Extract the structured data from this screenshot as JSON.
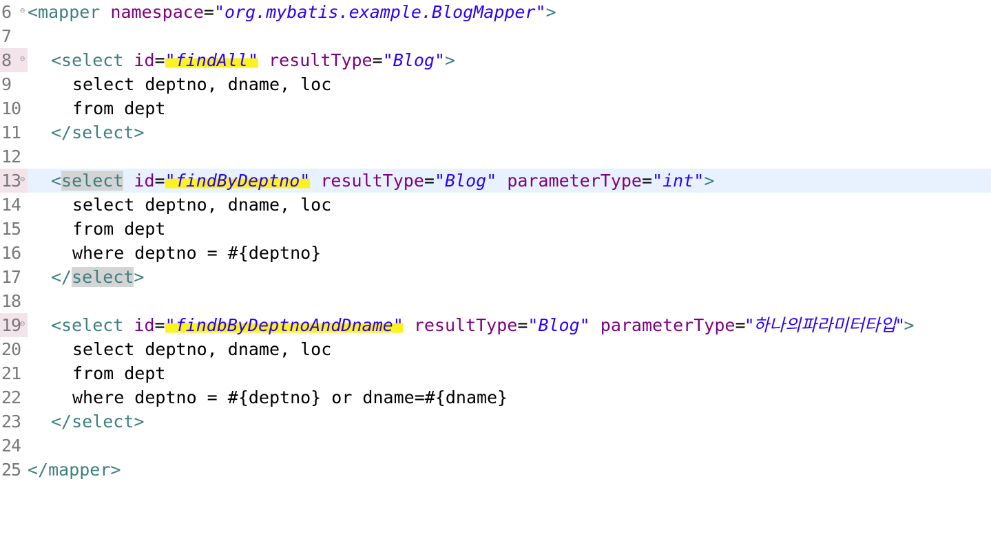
{
  "lines": {
    "l6": {
      "num": "6",
      "t1": "<mapper",
      "a1": " namespace",
      "eq": "=",
      "v1": "\"org.mybatis.example.BlogMapper\"",
      "t2": ">"
    },
    "l7": {
      "num": "7"
    },
    "l8": {
      "num": "8",
      "t1": "<select",
      "a1": " id",
      "v1": "\"findAll\"",
      "a2": " resultType",
      "v2": "\"Blog\"",
      "t2": ">"
    },
    "l9": {
      "num": "9",
      "text": "select deptno, dname, loc"
    },
    "l10": {
      "num": "10",
      "text": "from dept"
    },
    "l11": {
      "num": "11",
      "t1": "</select>"
    },
    "l12": {
      "num": "12"
    },
    "l13": {
      "num": "13",
      "t0": "<",
      "sel": "select",
      "a1": " id",
      "v1": "\"findByDeptno\"",
      "a2": " resultType",
      "v2": "\"Blog\"",
      "a3": " parameterType",
      "v3": "\"int\"",
      "t2": ">"
    },
    "l14": {
      "num": "14",
      "text": "select deptno, dname, loc"
    },
    "l15": {
      "num": "15",
      "text": "from dept"
    },
    "l16": {
      "num": "16",
      "text": "where deptno = #{deptno}"
    },
    "l17": {
      "num": "17",
      "t0": "</",
      "sel": "select",
      "t2": ">"
    },
    "l18": {
      "num": "18"
    },
    "l19": {
      "num": "19",
      "t1": "<select",
      "a1": " id",
      "v1": "\"findbByDeptnoAndDname\"",
      "a2": " resultType",
      "v2": "\"Blog\"",
      "a3": " parameterType",
      "v3": "\"하나의파라미터타입\"",
      "t2": ">"
    },
    "l20": {
      "num": "20",
      "text": "select deptno, dname, loc"
    },
    "l21": {
      "num": "21",
      "text": "from dept"
    },
    "l22": {
      "num": "22",
      "text": "where deptno = #{deptno} or dname=#{dname}"
    },
    "l23": {
      "num": "23",
      "t1": "</select>"
    },
    "l24": {
      "num": "24"
    },
    "l25": {
      "num": "25",
      "t1": "</mapper>"
    }
  },
  "equals": "=",
  "fold_glyph": "⊖",
  "colors": {
    "tag": "#3f7f7f",
    "attribute": "#7f007f",
    "value": "#2a00ff",
    "current_line": "#e8f2fe",
    "highlight": "#fbf31f"
  }
}
